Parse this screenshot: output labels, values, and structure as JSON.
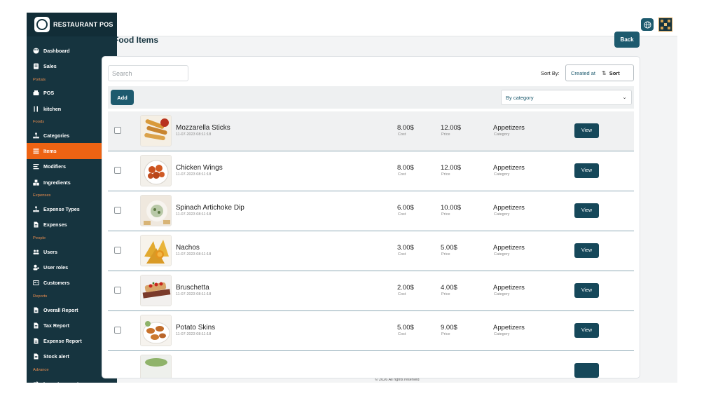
{
  "app": {
    "name": "RESTAURANT POS"
  },
  "sidebar": [
    {
      "kind": "item",
      "label": "Dashboard",
      "icon": "palette-icon"
    },
    {
      "kind": "item",
      "label": "Sales",
      "icon": "receipt-icon"
    },
    {
      "kind": "section",
      "label": "Portals"
    },
    {
      "kind": "item",
      "label": "POS",
      "icon": "cash-register-icon"
    },
    {
      "kind": "item",
      "label": "kitchen",
      "icon": "utensils-icon"
    },
    {
      "kind": "section",
      "label": "Foods"
    },
    {
      "kind": "item",
      "label": "Categories",
      "icon": "sitemap-icon"
    },
    {
      "kind": "item",
      "label": "Items",
      "icon": "list-icon",
      "active": true
    },
    {
      "kind": "item",
      "label": "Modifiers",
      "icon": "bars-icon"
    },
    {
      "kind": "item",
      "label": "Ingredients",
      "icon": "cubes-icon"
    },
    {
      "kind": "section",
      "label": "Expenses"
    },
    {
      "kind": "item",
      "label": "Expense Types",
      "icon": "sitemap-icon"
    },
    {
      "kind": "item",
      "label": "Expenses",
      "icon": "file-icon"
    },
    {
      "kind": "section",
      "label": "People"
    },
    {
      "kind": "item",
      "label": "Users",
      "icon": "users-icon"
    },
    {
      "kind": "item",
      "label": "User roles",
      "icon": "user-tag-icon"
    },
    {
      "kind": "item",
      "label": "Customers",
      "icon": "address-card-icon"
    },
    {
      "kind": "section",
      "label": "Reports"
    },
    {
      "kind": "item",
      "label": "Overall Report",
      "icon": "file-icon"
    },
    {
      "kind": "item",
      "label": "Tax Report",
      "icon": "file-icon"
    },
    {
      "kind": "item",
      "label": "Expense Report",
      "icon": "file-icon"
    },
    {
      "kind": "item",
      "label": "Stock alert",
      "icon": "file-icon"
    },
    {
      "kind": "section",
      "label": "Advance"
    },
    {
      "kind": "item",
      "label": "Imports exports",
      "icon": "exchange-icon"
    }
  ],
  "header": {
    "globe_icon": "globe-icon",
    "avatar_icon": "avatar-icon"
  },
  "page": {
    "title": "Food Items",
    "back_label": "Back"
  },
  "search": {
    "placeholder": "Search"
  },
  "sort": {
    "label": "Sort By:",
    "field": "Created at",
    "button": "Sort"
  },
  "toolbar": {
    "add_label": "Add",
    "category_value": "By category"
  },
  "columns": {
    "cost": "Cost",
    "price": "Price",
    "category": "Category"
  },
  "items": [
    {
      "name": "Mozzarella Sticks",
      "date": "11-07-2023 08:11:18",
      "cost": "8.00$",
      "price": "12.00$",
      "category": "Appetizers",
      "action": "View"
    },
    {
      "name": "Chicken Wings",
      "date": "11-07-2023 08:11:18",
      "cost": "8.00$",
      "price": "12.00$",
      "category": "Appetizers",
      "action": "View"
    },
    {
      "name": "Spinach Artichoke Dip",
      "date": "11-07-2023 08:11:18",
      "cost": "6.00$",
      "price": "10.00$",
      "category": "Appetizers",
      "action": "View"
    },
    {
      "name": "Nachos",
      "date": "11-07-2023 08:11:18",
      "cost": "3.00$",
      "price": "5.00$",
      "category": "Appetizers",
      "action": "View"
    },
    {
      "name": "Bruschetta",
      "date": "11-07-2023 08:11:18",
      "cost": "2.00$",
      "price": "4.00$",
      "category": "Appetizers",
      "action": "View"
    },
    {
      "name": "Potato Skins",
      "date": "11-07-2023 08:11:18",
      "cost": "5.00$",
      "price": "9.00$",
      "category": "Appetizers",
      "action": "View"
    }
  ],
  "footer": {
    "text": "© 2026 All rights reserved"
  },
  "colors": {
    "sidebar": "#16343f",
    "accent": "#ee6313",
    "primary": "#1d5a6e"
  }
}
